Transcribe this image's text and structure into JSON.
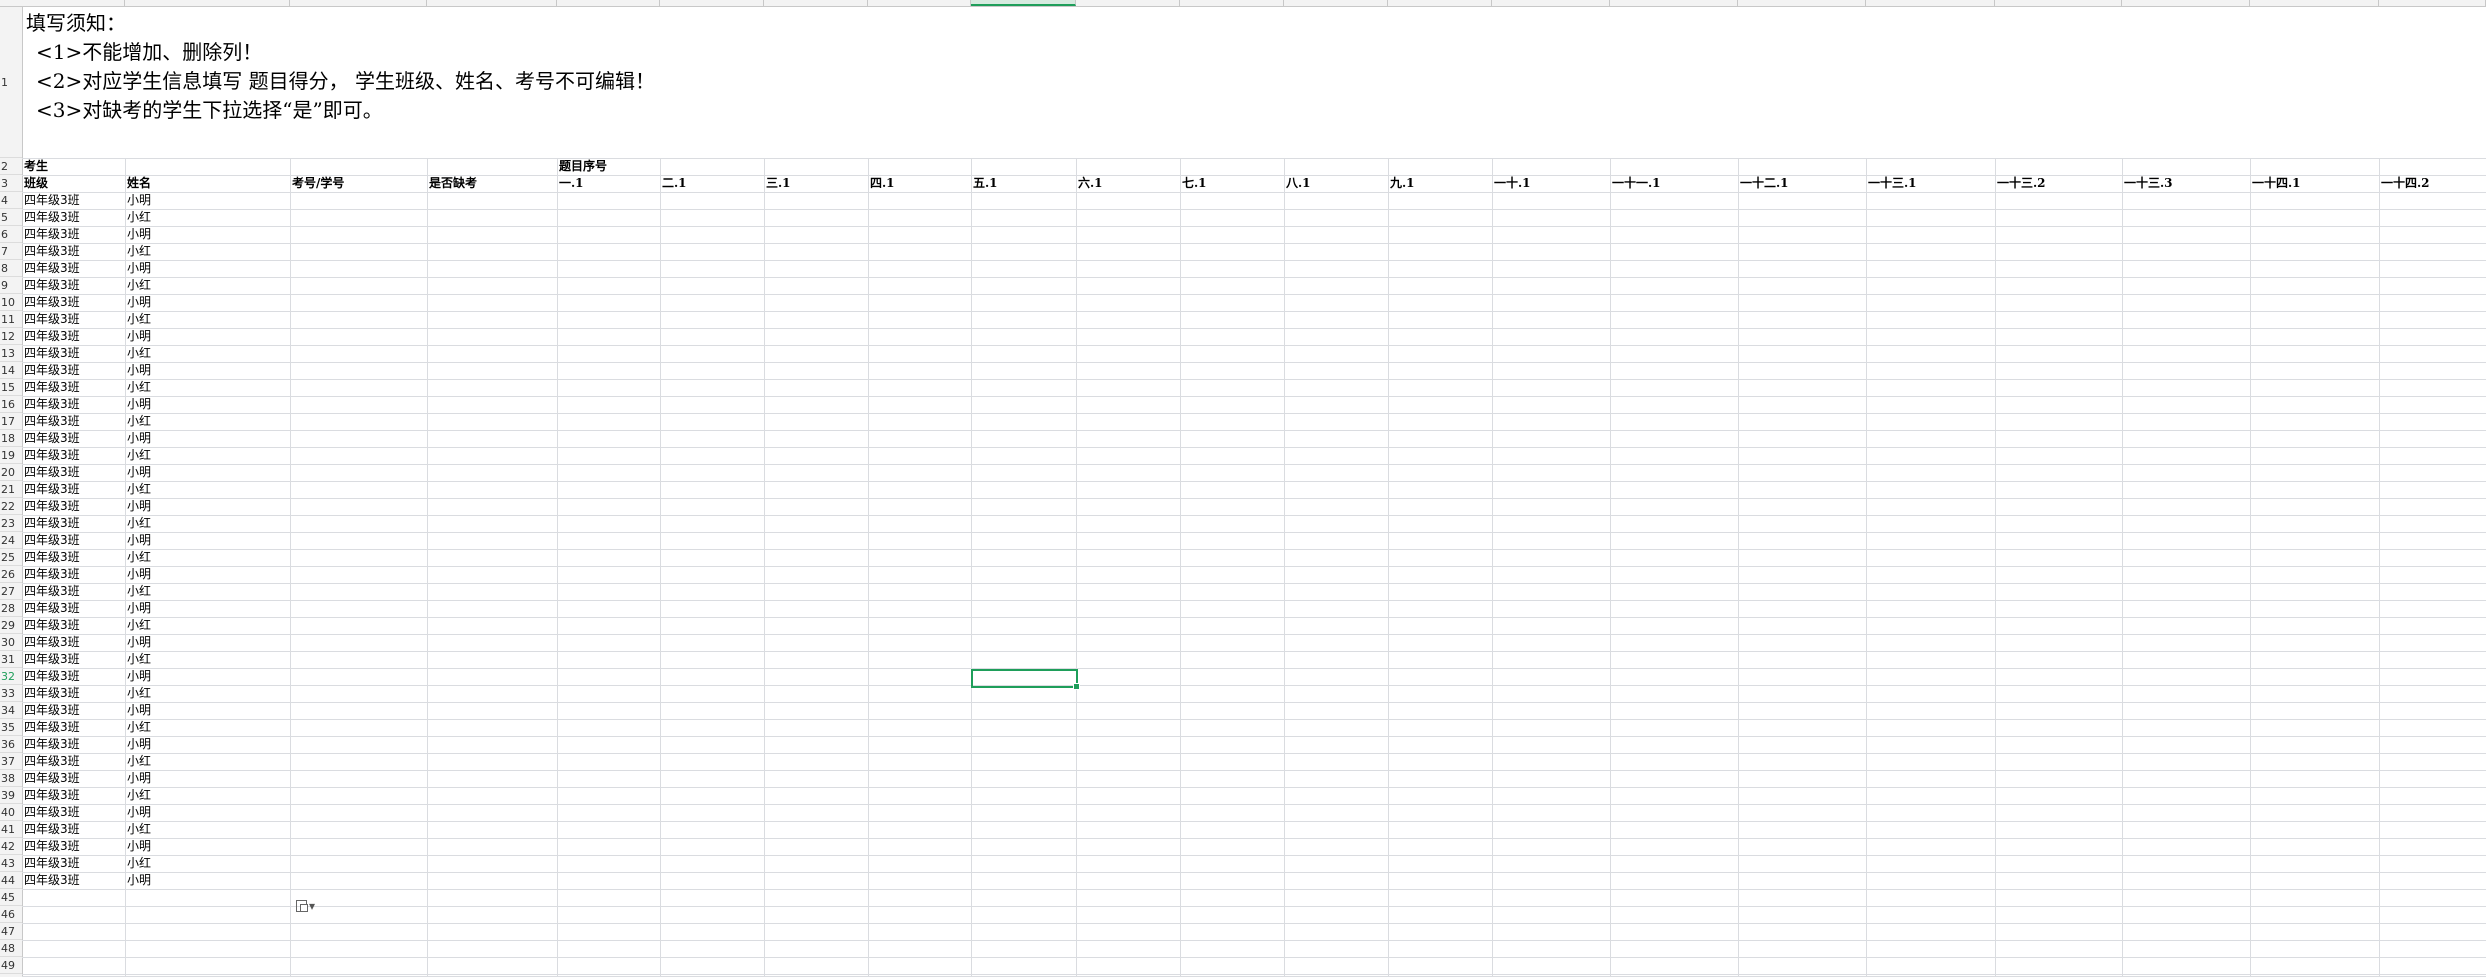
{
  "notice": {
    "title": "填写须知：",
    "lines": [
      "<1>不能增加、删除列！",
      "<2>对应学生信息填写 题目得分， 学生班级、姓名、考号不可编辑！",
      "<3>对缺考的学生下拉选择“是”即可。"
    ]
  },
  "row2": {
    "examinee_label": "考生",
    "question_no_label": "题目序号"
  },
  "headers": [
    "班级",
    "姓名",
    "考号/学号",
    "是否缺考",
    "一.1",
    "二.1",
    "三.1",
    "四.1",
    "五.1",
    "六.1",
    "七.1",
    "八.1",
    "九.1",
    "一十.1",
    "一十一.1",
    "一十二.1",
    "一十三.1",
    "一十三.2",
    "一十三.3",
    "一十四.1",
    "一十四.2"
  ],
  "row_numbers": [
    "1",
    "2",
    "3",
    "4",
    "5",
    "6",
    "7",
    "8",
    "9",
    "10",
    "11",
    "12",
    "13",
    "14",
    "15",
    "16",
    "17",
    "18",
    "19",
    "20",
    "21",
    "22",
    "23",
    "24",
    "25",
    "26",
    "27",
    "28",
    "29",
    "30",
    "31",
    "32",
    "33",
    "34",
    "35",
    "36",
    "37",
    "38",
    "39",
    "40",
    "41",
    "42",
    "43",
    "44",
    "45",
    "46",
    "47",
    "48",
    "49"
  ],
  "active_row": "32",
  "students": [
    {
      "class": "四年级3班",
      "name": "小明"
    },
    {
      "class": "四年级3班",
      "name": "小红"
    },
    {
      "class": "四年级3班",
      "name": "小明"
    },
    {
      "class": "四年级3班",
      "name": "小红"
    },
    {
      "class": "四年级3班",
      "name": "小明"
    },
    {
      "class": "四年级3班",
      "name": "小红"
    },
    {
      "class": "四年级3班",
      "name": "小明"
    },
    {
      "class": "四年级3班",
      "name": "小红"
    },
    {
      "class": "四年级3班",
      "name": "小明"
    },
    {
      "class": "四年级3班",
      "name": "小红"
    },
    {
      "class": "四年级3班",
      "name": "小明"
    },
    {
      "class": "四年级3班",
      "name": "小红"
    },
    {
      "class": "四年级3班",
      "name": "小明"
    },
    {
      "class": "四年级3班",
      "name": "小红"
    },
    {
      "class": "四年级3班",
      "name": "小明"
    },
    {
      "class": "四年级3班",
      "name": "小红"
    },
    {
      "class": "四年级3班",
      "name": "小明"
    },
    {
      "class": "四年级3班",
      "name": "小红"
    },
    {
      "class": "四年级3班",
      "name": "小明"
    },
    {
      "class": "四年级3班",
      "name": "小红"
    },
    {
      "class": "四年级3班",
      "name": "小明"
    },
    {
      "class": "四年级3班",
      "name": "小红"
    },
    {
      "class": "四年级3班",
      "name": "小明"
    },
    {
      "class": "四年级3班",
      "name": "小红"
    },
    {
      "class": "四年级3班",
      "name": "小明"
    },
    {
      "class": "四年级3班",
      "name": "小红"
    },
    {
      "class": "四年级3班",
      "name": "小明"
    },
    {
      "class": "四年级3班",
      "name": "小红"
    },
    {
      "class": "四年级3班",
      "name": "小明"
    },
    {
      "class": "四年级3班",
      "name": "小红"
    },
    {
      "class": "四年级3班",
      "name": "小明"
    },
    {
      "class": "四年级3班",
      "name": "小红"
    },
    {
      "class": "四年级3班",
      "name": "小明"
    },
    {
      "class": "四年级3班",
      "name": "小红"
    },
    {
      "class": "四年级3班",
      "name": "小明"
    },
    {
      "class": "四年级3班",
      "name": "小红"
    },
    {
      "class": "四年级3班",
      "name": "小明"
    },
    {
      "class": "四年级3班",
      "name": "小红"
    },
    {
      "class": "四年级3班",
      "name": "小明"
    },
    {
      "class": "四年级3班",
      "name": "小红"
    },
    {
      "class": "四年级3班",
      "name": "小明"
    }
  ],
  "icons": {
    "paste_options": "paste-options-icon",
    "dropdown": "chevron-down-icon"
  },
  "colors": {
    "accent": "#1e9e5a",
    "grid": "#dadce0",
    "header_bg": "#f3f3f3"
  }
}
